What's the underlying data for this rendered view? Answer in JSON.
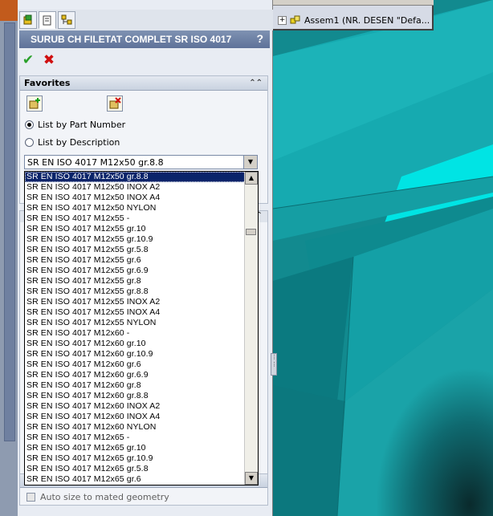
{
  "property_manager": {
    "title": "SURUB CH FILETAT COMPLET SR ISO 4017",
    "help_label": "?",
    "ok_label": "✔",
    "cancel_label": "✖"
  },
  "favorites": {
    "header": "Favorites",
    "collapse_glyph": "⌃⌃",
    "radio_part_number": "List by Part Number",
    "radio_description": "List by Description",
    "selected_radio": "part_number"
  },
  "combo": {
    "value": "SR EN ISO 4017 M12x50 gr.8.8"
  },
  "dropdown": {
    "items": [
      "SR EN ISO 4017 M12x50 gr.8.8",
      "SR EN ISO 4017 M12x50 INOX A2",
      "SR EN ISO 4017 M12x50 INOX A4",
      "SR EN ISO 4017 M12x50 NYLON",
      "SR EN ISO 4017 M12x55 -",
      "SR EN ISO 4017 M12x55 gr.10",
      "SR EN ISO 4017 M12x55 gr.10.9",
      "SR EN ISO 4017 M12x55 gr.5.8",
      "SR EN ISO 4017 M12x55 gr.6",
      "SR EN ISO 4017 M12x55 gr.6.9",
      "SR EN ISO 4017 M12x55 gr.8",
      "SR EN ISO 4017 M12x55 gr.8.8",
      "SR EN ISO 4017 M12x55 INOX A2",
      "SR EN ISO 4017 M12x55 INOX A4",
      "SR EN ISO 4017 M12x55 NYLON",
      "SR EN ISO 4017 M12x60 -",
      "SR EN ISO 4017 M12x60 gr.10",
      "SR EN ISO 4017 M12x60 gr.10.9",
      "SR EN ISO 4017 M12x60 gr.6",
      "SR EN ISO 4017 M12x60 gr.6.9",
      "SR EN ISO 4017 M12x60 gr.8",
      "SR EN ISO 4017 M12x60 gr.8.8",
      "SR EN ISO 4017 M12x60 INOX A2",
      "SR EN ISO 4017 M12x60 INOX A4",
      "SR EN ISO 4017 M12x60 NYLON",
      "SR EN ISO 4017 M12x65 -",
      "SR EN ISO 4017 M12x65 gr.10",
      "SR EN ISO 4017 M12x65 gr.10.9",
      "SR EN ISO 4017 M12x65 gr.5.8",
      "SR EN ISO 4017 M12x65 gr.6"
    ],
    "selected_index": 0
  },
  "bottom": {
    "auto_size_label": "Auto size to mated geometry",
    "auto_size_checked": false
  },
  "tree": {
    "expand_glyph": "+",
    "item_label": "Assem1  (NR. DESEN \"Defa..."
  },
  "colors": {
    "title_bar": "#6a7ea3",
    "selection": "#0a246a",
    "model_teal": "#1aa3a8",
    "background_cyan": "#00e0e0"
  }
}
